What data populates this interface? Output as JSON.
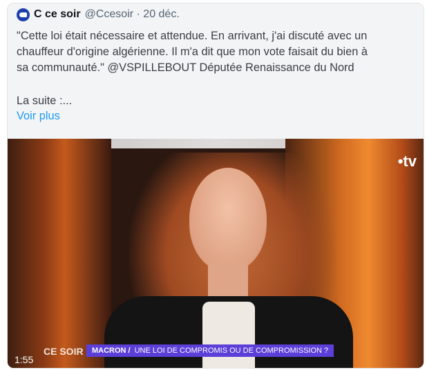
{
  "tweet": {
    "author_name": "C ce soir",
    "handle_and_date": "@Ccesoir · 20 déc.",
    "lines": [
      "\"Cette loi était nécessaire et attendue. En arrivant, j'ai discuté avec un",
      "chauffeur d'origine algérienne. Il m'a dit que mon vote faisait du bien à",
      "sa communauté.\" @VSPILLEBOUT Députée Renaissance du Nord"
    ],
    "suite": "La suite :...",
    "more": "Voir plus"
  },
  "video": {
    "channel_logo": "•tv",
    "timestamp": "1:55",
    "show_logo": "CE SOIR",
    "banner_keyword": "MACRON /",
    "banner_text": "UNE LOI DE COMPROMIS OU DE COMPROMISSION ?"
  }
}
